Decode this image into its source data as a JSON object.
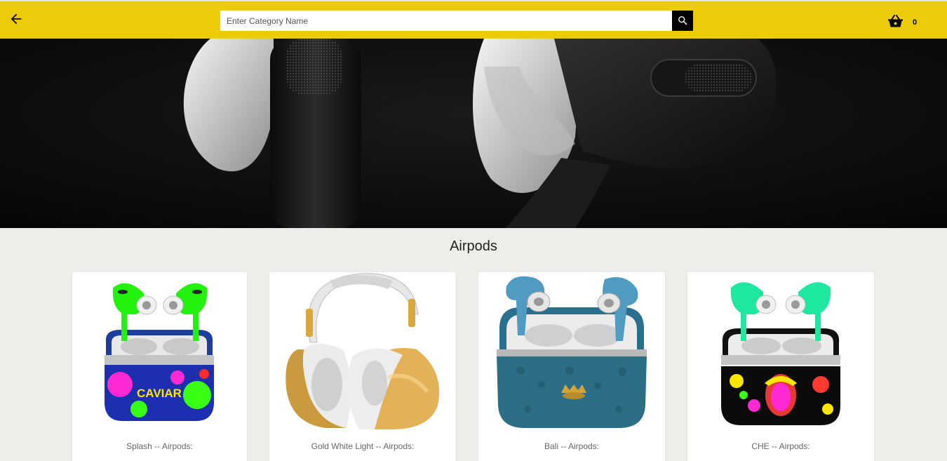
{
  "header": {
    "search": {
      "placeholder": "Enter Category Name",
      "value": ""
    },
    "cart_count": "0",
    "accent_color": "#eccb09"
  },
  "section": {
    "title": "Airpods"
  },
  "products": [
    {
      "name": "Splash -- Airpods:"
    },
    {
      "name": "Gold White Light -- Airpods:"
    },
    {
      "name": "Bali -- Airpods:"
    },
    {
      "name": "CHE -- Airpods:"
    }
  ]
}
